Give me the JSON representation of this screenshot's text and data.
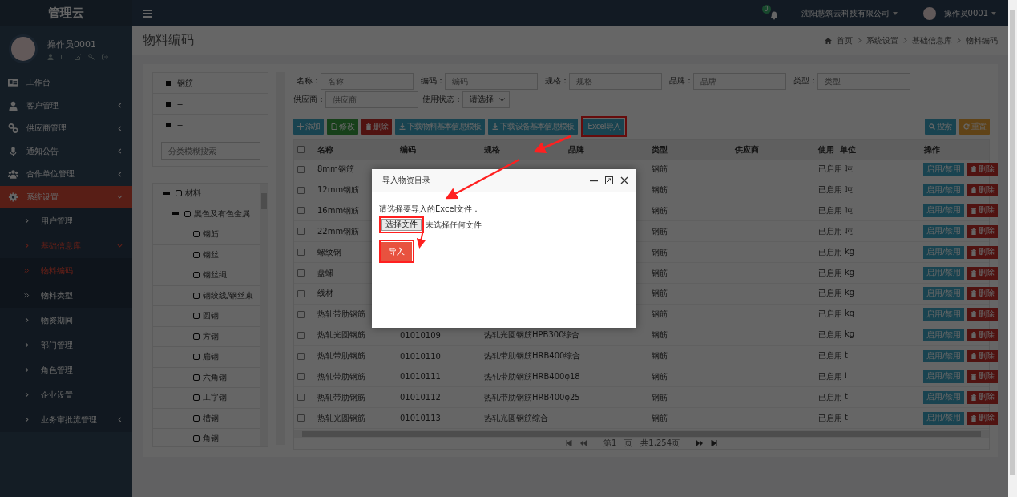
{
  "topbar": {
    "logo": "管理云",
    "notification_count": "0",
    "company": "沈阳慧筑云科技有限公司",
    "user": "操作员0001"
  },
  "profile": {
    "name": "操作员0001"
  },
  "sidebar": {
    "items": [
      {
        "label": "工作台",
        "kind": "link",
        "selected": false
      },
      {
        "label": "客户管理",
        "kind": "menu",
        "selected": false,
        "expanded": false
      },
      {
        "label": "供应商管理",
        "kind": "menu",
        "selected": false,
        "expanded": false
      },
      {
        "label": "通知公告",
        "kind": "menu",
        "selected": false,
        "expanded": false
      },
      {
        "label": "合作单位管理",
        "kind": "menu",
        "selected": false,
        "expanded": false
      },
      {
        "label": "系统设置",
        "kind": "menu",
        "selected": true,
        "expanded": true,
        "children": [
          {
            "label": "用户管理",
            "kind": "link",
            "selected": false
          },
          {
            "label": "基础信息库",
            "kind": "menu",
            "selected": true,
            "expanded": true,
            "children": [
              {
                "label": "物料编码",
                "kind": "link",
                "selected": true
              },
              {
                "label": "物料类型",
                "kind": "link",
                "selected": false
              }
            ]
          },
          {
            "label": "物资期间",
            "kind": "link",
            "selected": false
          },
          {
            "label": "部门管理",
            "kind": "link",
            "selected": false
          },
          {
            "label": "角色管理",
            "kind": "link",
            "selected": false
          },
          {
            "label": "企业设置",
            "kind": "link",
            "selected": false
          },
          {
            "label": "业务审批流管理",
            "kind": "menu",
            "selected": false,
            "expanded": false
          }
        ]
      }
    ]
  },
  "page": {
    "title": "物料编码",
    "breadcrumb": [
      "首页",
      "系统设置",
      "基础信息库",
      "物料编码"
    ]
  },
  "category_list": [
    "钢筋",
    "--",
    "--"
  ],
  "category_search": {
    "placeholder": "分类模糊搜索"
  },
  "tree": [
    {
      "label": "材料",
      "checked": false,
      "expanded": true,
      "children": [
        {
          "label": "黑色及有色金属",
          "checked": false,
          "expanded": true,
          "children": [
            {
              "label": "钢筋",
              "checked": false
            },
            {
              "label": "钢丝",
              "checked": false
            },
            {
              "label": "钢丝绳",
              "checked": false
            },
            {
              "label": "钢绞线/钢丝束",
              "checked": false
            },
            {
              "label": "圆钢",
              "checked": false
            },
            {
              "label": "方钢",
              "checked": false
            },
            {
              "label": "扁钢",
              "checked": false
            },
            {
              "label": "六角钢",
              "checked": false
            },
            {
              "label": "工字钢",
              "checked": false
            },
            {
              "label": "槽钢",
              "checked": false
            },
            {
              "label": "角钢",
              "checked": false
            }
          ]
        }
      ]
    }
  ],
  "filters": [
    {
      "kind": "text",
      "label": "名称：",
      "placeholder": "名称"
    },
    {
      "kind": "text",
      "label": "编码：",
      "placeholder": "编码"
    },
    {
      "kind": "text",
      "label": "规格：",
      "placeholder": "规格"
    },
    {
      "kind": "text",
      "label": "品牌：",
      "placeholder": "品牌"
    },
    {
      "kind": "text",
      "label": "类型：",
      "placeholder": "类型"
    },
    {
      "kind": "text",
      "label": "供应商：",
      "placeholder": "供应商"
    },
    {
      "kind": "select",
      "label": "使用状态：",
      "value": "请选择"
    }
  ],
  "toolbar": [
    {
      "kind": "add",
      "label": "添加",
      "highlighted": false
    },
    {
      "kind": "edit",
      "label": "修改",
      "highlighted": false
    },
    {
      "kind": "delete",
      "label": "删除",
      "highlighted": false
    },
    {
      "kind": "download",
      "label": "下载物料基本信息模板",
      "highlighted": false
    },
    {
      "kind": "download",
      "label": "下载设备基本信息模板",
      "highlighted": false
    },
    {
      "kind": "import",
      "label": "Excel导入",
      "highlighted": true
    }
  ],
  "toolbar_right": [
    {
      "kind": "search",
      "label": "搜索"
    },
    {
      "kind": "reset",
      "label": "重置"
    }
  ],
  "table": {
    "header_checked": false,
    "columns": [
      "名称",
      "编码",
      "规格",
      "品牌",
      "类型",
      "供应商",
      "使用",
      "单位",
      "操作"
    ],
    "rows": [
      {
        "checked": false,
        "name": "8mm钢筋",
        "type": "钢筋",
        "status": "已启用",
        "unit": "吨",
        "actions": [
          "启用/禁用",
          "删除"
        ]
      },
      {
        "checked": false,
        "name": "12mm钢筋",
        "type": "钢筋",
        "status": "已启用",
        "unit": "吨",
        "actions": [
          "启用/禁用",
          "删除"
        ]
      },
      {
        "checked": false,
        "name": "16mm钢筋",
        "type": "钢筋",
        "status": "已启用",
        "unit": "吨",
        "actions": [
          "启用/禁用",
          "删除"
        ]
      },
      {
        "checked": false,
        "name": "22mm钢筋",
        "type": "钢筋",
        "status": "已启用",
        "unit": "吨",
        "actions": [
          "启用/禁用",
          "删除"
        ]
      },
      {
        "checked": false,
        "name": "螺纹钢",
        "type": "钢筋",
        "status": "已启用",
        "unit": "kg",
        "actions": [
          "启用/禁用",
          "删除"
        ]
      },
      {
        "checked": false,
        "name": "盘螺",
        "type": "钢筋",
        "status": "已启用",
        "unit": "kg",
        "actions": [
          "启用/禁用",
          "删除"
        ]
      },
      {
        "checked": false,
        "name": "线材",
        "type": "钢筋",
        "status": "已启用",
        "unit": "kg",
        "actions": [
          "启用/禁用",
          "删除"
        ]
      },
      {
        "checked": false,
        "name": "热轧带肋钢筋",
        "type": "钢筋",
        "status": "已启用",
        "unit": "kg",
        "actions": [
          "启用/禁用",
          "删除"
        ]
      },
      {
        "checked": false,
        "name": "热轧光圆钢筋",
        "code": "01010109",
        "spec": "热轧光圆钢筋HPB300综合",
        "type": "钢筋",
        "status": "已启用",
        "unit": "kg",
        "actions": [
          "启用/禁用",
          "删除"
        ]
      },
      {
        "checked": false,
        "name": "热轧带肋钢筋",
        "code": "01010110",
        "spec": "热轧带肋钢筋HRB400综合",
        "type": "钢筋",
        "status": "已启用",
        "unit": "t",
        "actions": [
          "启用/禁用",
          "删除"
        ]
      },
      {
        "checked": false,
        "name": "热轧带肋钢筋",
        "code": "01010111",
        "spec": "热轧带肋钢筋HRB400φ18",
        "type": "钢筋",
        "status": "已启用",
        "unit": "t",
        "actions": [
          "启用/禁用",
          "删除"
        ]
      },
      {
        "checked": false,
        "name": "热轧带肋钢筋",
        "code": "01010112",
        "spec": "热轧带肋钢筋HRB400φ25",
        "type": "钢筋",
        "status": "已启用",
        "unit": "t",
        "actions": [
          "启用/禁用",
          "删除"
        ]
      },
      {
        "checked": false,
        "name": "热轧光圆钢筋",
        "code": "01010113",
        "spec": "热轧光圆钢筋综合",
        "type": "钢筋",
        "status": "已启用",
        "unit": "t",
        "actions": [
          "启用/禁用",
          "删除"
        ]
      }
    ]
  },
  "pagination": {
    "page": "第1",
    "page_unit": "页",
    "total": "共1,254页"
  },
  "modal": {
    "title": "导入物资目录",
    "prompt": "请选择要导入的Excel文件：",
    "file_button": {
      "label": "选择文件",
      "highlighted": true
    },
    "file_status": "未选择任何文件",
    "submit": {
      "label": "导入",
      "highlighted": true
    }
  }
}
